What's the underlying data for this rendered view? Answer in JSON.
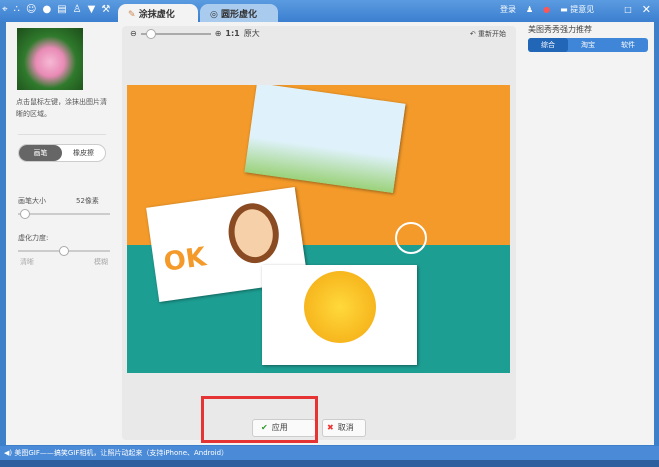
{
  "toolbar": {
    "icons": [
      "pin-icon",
      "dots-icon",
      "smile-icon",
      "mic-icon",
      "keyboard-icon",
      "user-icon",
      "shirt-icon",
      "wrench-icon"
    ]
  },
  "tabs": [
    {
      "label": "涂抹虚化"
    },
    {
      "label": "圆形虚化"
    }
  ],
  "top_right": {
    "login": "登录",
    "feedback": "提意见"
  },
  "left": {
    "hint": "点击鼠标左键，涂抹出图片清晰的区域。",
    "brush": "画笔",
    "eraser": "橡皮擦",
    "brush_size_label": "画笔大小",
    "brush_size_value": "52像素",
    "blur_label": "虚化力度:",
    "blur_min": "清晰",
    "blur_max": "模糊",
    "brush_size_fraction": 0.05,
    "blur_fraction": 0.5
  },
  "main": {
    "zoom_ratio": "1:1",
    "zoom_label": "原大",
    "reset": "重新开始",
    "apply": "应用",
    "cancel": "取消"
  },
  "right": {
    "title": "美图秀秀强力推荐",
    "tabs": [
      "综合",
      "淘宝",
      "软件"
    ]
  },
  "status": {
    "text": "美图GIF——搞笑GIF相机，让照片动起来（支持iPhone、Android）"
  }
}
